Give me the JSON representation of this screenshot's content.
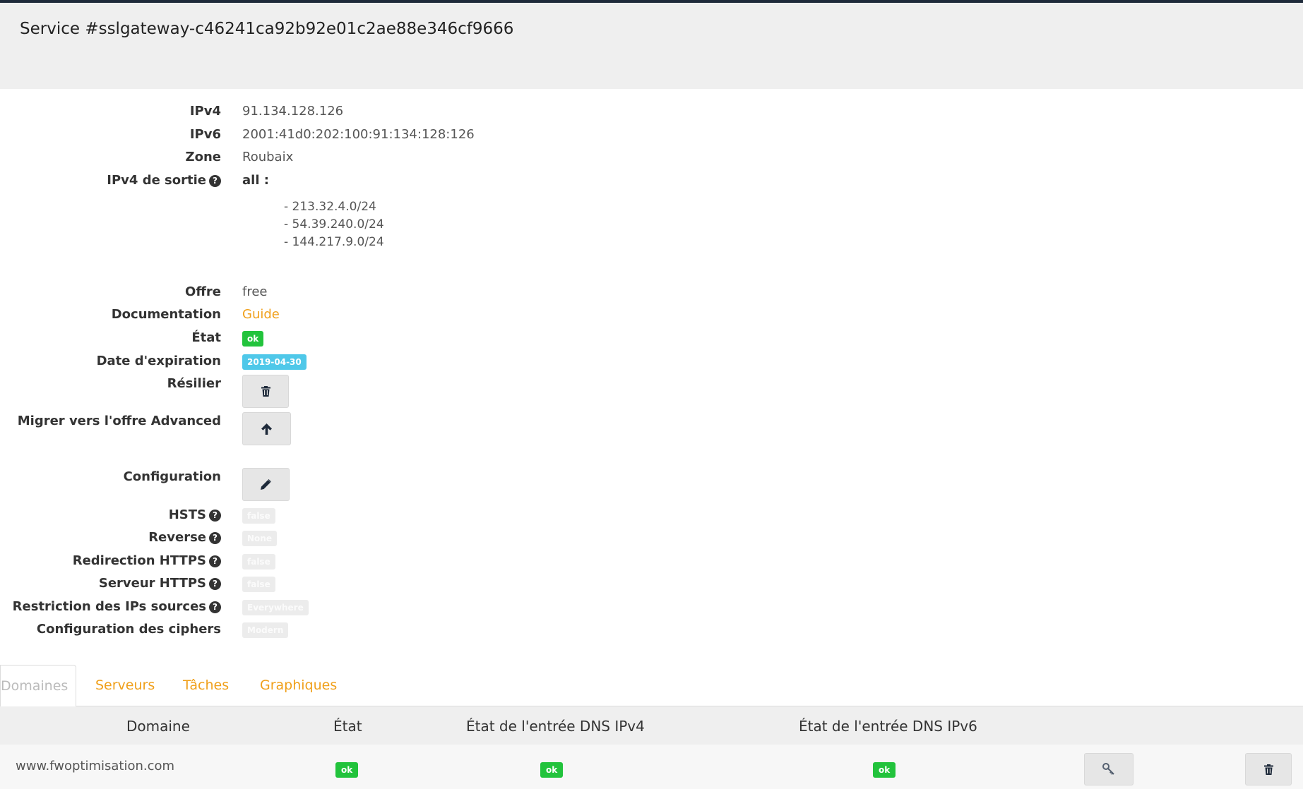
{
  "header": {
    "title": "Service #sslgateway-c46241ca92b92e01c2ae88e346cf9666"
  },
  "details": {
    "ipv4": {
      "label": "IPv4",
      "value": "91.134.128.126"
    },
    "ipv6": {
      "label": "IPv6",
      "value": "2001:41d0:202:100:91:134:128:126"
    },
    "zone": {
      "label": "Zone",
      "value": "Roubaix"
    },
    "egress": {
      "label": "IPv4 de sortie",
      "value": "all :",
      "ranges": [
        "- 213.32.4.0/24",
        "- 54.39.240.0/24",
        "- 144.217.9.0/24"
      ]
    },
    "offer": {
      "label": "Offre",
      "value": "free"
    },
    "documentation": {
      "label": "Documentation",
      "link": "Guide"
    },
    "state": {
      "label": "État",
      "badge": "ok"
    },
    "expiration": {
      "label": "Date d'expiration",
      "badge": "2019-04-30"
    },
    "terminate": {
      "label": "Résilier"
    },
    "migrate": {
      "label": "Migrer vers l'offre Advanced"
    },
    "configuration": {
      "label": "Configuration"
    },
    "hsts": {
      "label": "HSTS",
      "badge": "false"
    },
    "reverse": {
      "label": "Reverse",
      "badge": "None"
    },
    "https_redirect": {
      "label": "Redirection HTTPS",
      "badge": "false"
    },
    "https_server": {
      "label": "Serveur HTTPS",
      "badge": "false"
    },
    "ip_restriction": {
      "label": "Restriction des IPs sources",
      "badge": "Everywhere"
    },
    "ciphers": {
      "label": "Configuration des ciphers",
      "badge": "Modern"
    }
  },
  "tabs": [
    "Domaines",
    "Serveurs",
    "Tâches",
    "Graphiques"
  ],
  "table": {
    "headers": [
      "Domaine",
      "État",
      "État de l'entrée DNS IPv4",
      "État de l'entrée DNS IPv6"
    ],
    "rows": [
      {
        "domain": "www.fwoptimisation.com",
        "state": "ok",
        "dns_ipv4": "ok",
        "dns_ipv6": "ok"
      }
    ]
  },
  "colors": {
    "accent": "#f0a01b",
    "ok": "#22c33c",
    "date_badge": "#4fc8e9"
  },
  "icons": {
    "help": "question-circle-icon",
    "delete": "trash-icon",
    "migrate": "arrow-up-icon",
    "edit": "pencil-icon",
    "key": "key-icon"
  }
}
